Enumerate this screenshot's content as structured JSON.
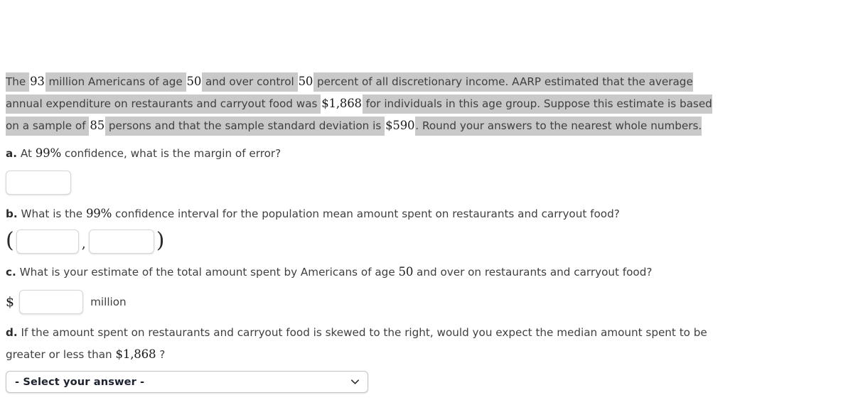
{
  "problem": {
    "lines": [
      [
        {
          "t": "The ",
          "style": "plain"
        },
        {
          "t": "93",
          "style": "value"
        },
        {
          "t": " million Americans of age ",
          "style": "plain"
        },
        {
          "t": "50",
          "style": "value"
        },
        {
          "t": " and over control ",
          "style": "plain"
        },
        {
          "t": "50",
          "style": "value"
        },
        {
          "t": " percent of all discretionary income. AARP estimated that the average",
          "style": "plain"
        }
      ],
      [
        {
          "t": "annual expenditure on restaurants and carryout food was ",
          "style": "plain"
        },
        {
          "t": "$1,868",
          "style": "value"
        },
        {
          "t": " for individuals in this age group. Suppose this estimate is based",
          "style": "plain"
        }
      ],
      [
        {
          "t": "on a sample of ",
          "style": "plain"
        },
        {
          "t": "85",
          "style": "value"
        },
        {
          "t": " persons and that the sample standard deviation is ",
          "style": "plain"
        },
        {
          "t": "$590",
          "style": "value"
        },
        {
          "t": ". Round your answers to the nearest whole numbers.",
          "style": "plain"
        }
      ]
    ]
  },
  "questions": {
    "a": {
      "label": "a.",
      "text_before": " At ",
      "math": "99%",
      "text_after": " confidence, what is the margin of error?",
      "answer_value": "",
      "answer_placeholder": ""
    },
    "b": {
      "label": "b.",
      "text_before": " What is the ",
      "math": "99%",
      "text_after": " confidence interval for the population mean amount spent on restaurants and carryout food?",
      "open_paren": "(",
      "comma": ",",
      "close_paren": ")",
      "lower_value": "",
      "upper_value": "",
      "lower_placeholder": "",
      "upper_placeholder": ""
    },
    "c": {
      "label": "c.",
      "text_before": " What is your estimate of the total amount spent by Americans of age ",
      "math": "50",
      "text_after": " and over on restaurants and carryout food?",
      "currency_symbol": "$",
      "unit": "million",
      "answer_value": "",
      "answer_placeholder": ""
    },
    "d": {
      "label": "d.",
      "line1": " If the amount spent on restaurants and carryout food is skewed to the right, would you expect the median amount spent to be",
      "line2_before": "greater or less than ",
      "line2_math": "$1,868",
      "line2_after": " ?",
      "select_label": "- Select your answer -",
      "select_icon": "chevron-down-icon"
    }
  },
  "colors": {
    "highlight_gray": "#c9c9c9",
    "value_background": "#ffffff",
    "text": "#3f3f3f",
    "page_background": "#ffffff"
  }
}
